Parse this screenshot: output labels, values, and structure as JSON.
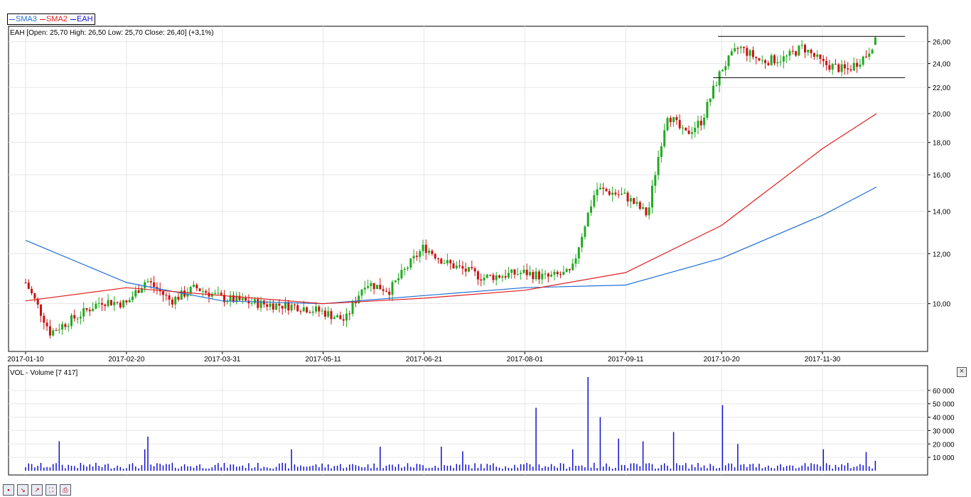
{
  "legend": {
    "items": [
      {
        "label": "SMA3",
        "color": "#1f6fd6"
      },
      {
        "label": "SMA2",
        "color": "#e02020"
      },
      {
        "label": "EAH",
        "color": "#1010d0"
      }
    ]
  },
  "price_info": "EAH [Open: 25,70  High: 26,50  Low: 25,70  Close: 26,40] (+3,1%)",
  "volume_info": "VOL - Volume [7 417]",
  "toolbar": {
    "icons": [
      "save-icon",
      "zoom-in-icon",
      "zoom-out-icon",
      "fit-icon",
      "print-icon"
    ]
  },
  "colors": {
    "up": "#22aa22",
    "down": "#cc1111",
    "volume": "#1010d0",
    "sma_long": "#1f6fd6",
    "sma_short": "#e02020"
  },
  "chart_data": [
    {
      "type": "candlestick",
      "title": "EAH",
      "x_ticks": [
        "2017-01-10",
        "2017-02-20",
        "2017-03-31",
        "2017-05-11",
        "2017-06-21",
        "2017-08-01",
        "2017-09-11",
        "2017-10-20",
        "2017-11-30"
      ],
      "y_ticks": [
        "10,00",
        "12,00",
        "14,00",
        "16,00",
        "18,00",
        "20,00",
        "22,00",
        "24,00",
        "26,00"
      ],
      "y_scale": "log",
      "ylim": [
        8.4,
        27.5
      ],
      "grid": true,
      "last_bar": {
        "open": 25.7,
        "high": 26.5,
        "low": 25.7,
        "close": 26.4,
        "change_pct": 3.1
      },
      "close_anchors": [
        [
          "2017-01-10",
          10.8
        ],
        [
          "2017-01-20",
          9.0
        ],
        [
          "2017-02-01",
          9.6
        ],
        [
          "2017-02-10",
          10.1
        ],
        [
          "2017-02-20",
          10.0
        ],
        [
          "2017-02-28",
          10.9
        ],
        [
          "2017-03-10",
          10.1
        ],
        [
          "2017-03-20",
          10.6
        ],
        [
          "2017-03-31",
          10.2
        ],
        [
          "2017-04-15",
          10.0
        ],
        [
          "2017-05-01",
          9.9
        ],
        [
          "2017-05-11",
          9.7
        ],
        [
          "2017-05-20",
          9.4
        ],
        [
          "2017-05-28",
          10.8
        ],
        [
          "2017-06-07",
          10.5
        ],
        [
          "2017-06-21",
          12.3
        ],
        [
          "2017-06-30",
          11.6
        ],
        [
          "2017-07-15",
          11.0
        ],
        [
          "2017-08-01",
          11.2
        ],
        [
          "2017-08-10",
          11.0
        ],
        [
          "2017-08-20",
          11.2
        ],
        [
          "2017-08-30",
          15.2
        ],
        [
          "2017-09-11",
          14.8
        ],
        [
          "2017-09-20",
          13.8
        ],
        [
          "2017-09-28",
          20.0
        ],
        [
          "2017-10-05",
          18.5
        ],
        [
          "2017-10-12",
          19.5
        ],
        [
          "2017-10-20",
          23.5
        ],
        [
          "2017-10-27",
          25.5
        ],
        [
          "2017-11-05",
          24.2
        ],
        [
          "2017-11-15",
          24.5
        ],
        [
          "2017-11-22",
          25.5
        ],
        [
          "2017-11-30",
          24.0
        ],
        [
          "2017-12-10",
          23.4
        ],
        [
          "2017-12-18",
          24.8
        ],
        [
          "2017-12-22",
          26.4
        ]
      ],
      "resistance_line": 26.5,
      "support_line": 22.8,
      "series": [
        {
          "name": "SMA3",
          "color": "#1f6fd6",
          "points": [
            [
              "2017-01-10",
              12.6
            ],
            [
              "2017-02-20",
              10.8
            ],
            [
              "2017-03-31",
              10.1
            ],
            [
              "2017-05-11",
              10.0
            ],
            [
              "2017-06-21",
              10.3
            ],
            [
              "2017-08-01",
              10.6
            ],
            [
              "2017-09-11",
              10.7
            ],
            [
              "2017-10-20",
              11.8
            ],
            [
              "2017-11-30",
              13.8
            ],
            [
              "2017-12-22",
              15.3
            ]
          ]
        },
        {
          "name": "SMA2",
          "color": "#e02020",
          "points": [
            [
              "2017-01-10",
              10.1
            ],
            [
              "2017-02-20",
              10.6
            ],
            [
              "2017-03-31",
              10.3
            ],
            [
              "2017-05-11",
              10.0
            ],
            [
              "2017-06-21",
              10.2
            ],
            [
              "2017-08-01",
              10.5
            ],
            [
              "2017-09-11",
              11.2
            ],
            [
              "2017-10-20",
              13.3
            ],
            [
              "2017-11-30",
              17.6
            ],
            [
              "2017-12-22",
              20.0
            ]
          ]
        }
      ]
    },
    {
      "type": "bar",
      "title": "VOL - Volume",
      "y_ticks": [
        "10 000",
        "20 000",
        "30 000",
        "40 000",
        "50 000",
        "60 000"
      ],
      "ylim": [
        0,
        70000
      ],
      "grid": true,
      "last_value": 7417,
      "peaks": [
        [
          "2017-01-24",
          22000
        ],
        [
          "2017-03-01",
          25500
        ],
        [
          "2017-02-27",
          16000
        ],
        [
          "2017-04-28",
          16000
        ],
        [
          "2017-06-03",
          18000
        ],
        [
          "2017-06-28",
          18000
        ],
        [
          "2017-07-07",
          14500
        ],
        [
          "2017-08-05",
          47000
        ],
        [
          "2017-08-27",
          70000
        ],
        [
          "2017-09-01",
          40000
        ],
        [
          "2017-08-20",
          16000
        ],
        [
          "2017-09-08",
          24000
        ],
        [
          "2017-09-18",
          22000
        ],
        [
          "2017-10-01",
          29000
        ],
        [
          "2017-10-20",
          49000
        ],
        [
          "2017-10-26",
          20000
        ],
        [
          "2017-11-30",
          16000
        ],
        [
          "2017-12-18",
          14000
        ]
      ]
    }
  ]
}
